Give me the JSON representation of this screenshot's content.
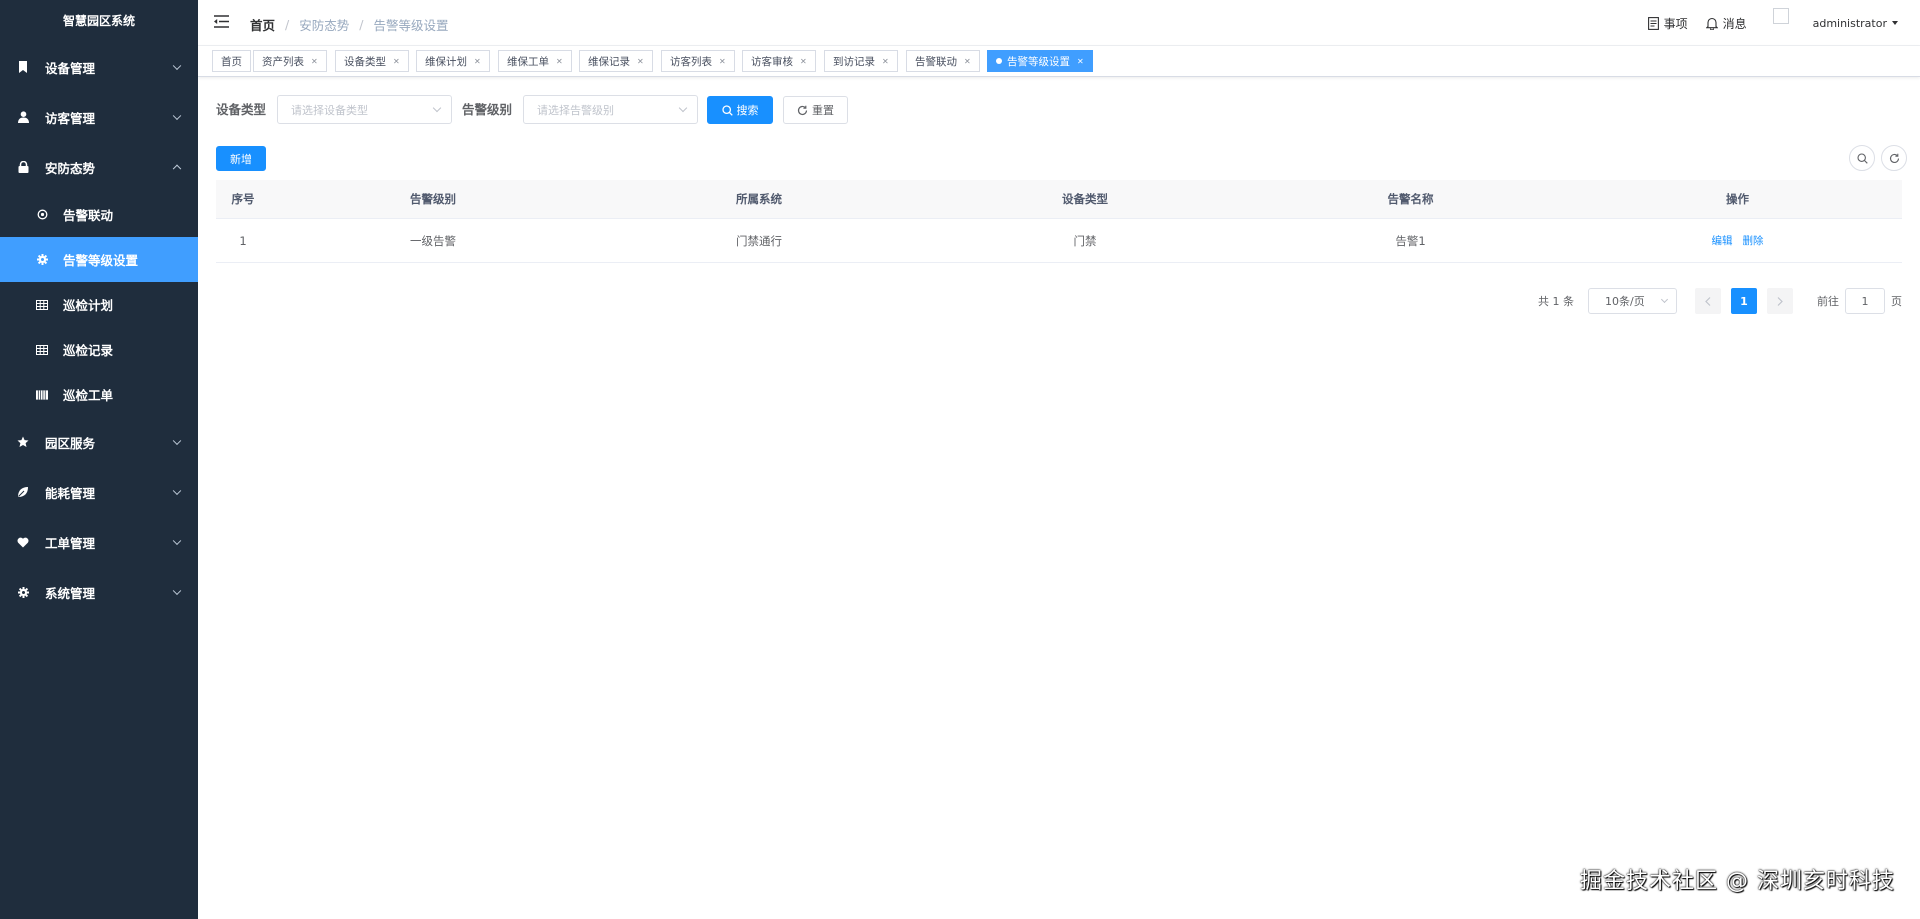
{
  "app": {
    "title": "智慧园区系统"
  },
  "sidebar": {
    "menus": [
      {
        "label": "设备管理",
        "icon": "bookmark-icon",
        "expanded": false
      },
      {
        "label": "访客管理",
        "icon": "user-icon",
        "expanded": false
      },
      {
        "label": "安防态势",
        "icon": "lock-icon",
        "expanded": true,
        "children": [
          {
            "label": "告警联动",
            "icon": "link-icon",
            "active": false
          },
          {
            "label": "告警等级设置",
            "icon": "gear-icon",
            "active": true
          },
          {
            "label": "巡检计划",
            "icon": "table-icon",
            "active": false
          },
          {
            "label": "巡检记录",
            "icon": "table-icon",
            "active": false
          },
          {
            "label": "巡检工单",
            "icon": "list-icon",
            "active": false
          }
        ]
      },
      {
        "label": "园区服务",
        "icon": "star-icon",
        "expanded": false
      },
      {
        "label": "能耗管理",
        "icon": "leaf-icon",
        "expanded": false
      },
      {
        "label": "工单管理",
        "icon": "heart-icon",
        "expanded": false
      },
      {
        "label": "系统管理",
        "icon": "gear-icon",
        "expanded": false
      }
    ]
  },
  "header": {
    "breadcrumb": [
      "首页",
      "安防态势",
      "告警等级设置"
    ],
    "todo_label": "事项",
    "message_label": "消息",
    "username": "administrator"
  },
  "tags": [
    {
      "label": "首页",
      "closable": false,
      "active": false
    },
    {
      "label": "资产列表",
      "closable": true,
      "active": false
    },
    {
      "label": "设备类型",
      "closable": true,
      "active": false
    },
    {
      "label": "维保计划",
      "closable": true,
      "active": false
    },
    {
      "label": "维保工单",
      "closable": true,
      "active": false
    },
    {
      "label": "维保记录",
      "closable": true,
      "active": false
    },
    {
      "label": "访客列表",
      "closable": true,
      "active": false
    },
    {
      "label": "访客审核",
      "closable": true,
      "active": false
    },
    {
      "label": "到访记录",
      "closable": true,
      "active": false
    },
    {
      "label": "告警联动",
      "closable": true,
      "active": false
    },
    {
      "label": "告警等级设置",
      "closable": true,
      "active": true
    }
  ],
  "filters": {
    "device_type_label": "设备类型",
    "device_type_placeholder": "请选择设备类型",
    "alarm_level_label": "告警级别",
    "alarm_level_placeholder": "请选择告警级别",
    "search_label": "搜索",
    "reset_label": "重置"
  },
  "toolbar": {
    "add_label": "新增"
  },
  "table": {
    "columns": [
      "序号",
      "告警级别",
      "所属系统",
      "设备类型",
      "告警名称",
      "操作"
    ],
    "rows": [
      {
        "index": "1",
        "level": "一级告警",
        "system": "门禁通行",
        "device_type": "门禁",
        "name": "告警1",
        "edit_label": "编辑",
        "delete_label": "删除"
      }
    ]
  },
  "pagination": {
    "total_text": "共 1 条",
    "page_size": "10条/页",
    "current_page": "1",
    "goto_label": "前往",
    "goto_value": "1",
    "page_suffix": "页"
  },
  "watermark": "掘金技术社区 @ 深圳亥时科技",
  "colors": {
    "sidebar_bg": "#1f2d3d",
    "primary": "#1890ff",
    "active_menu": "#409eff"
  }
}
